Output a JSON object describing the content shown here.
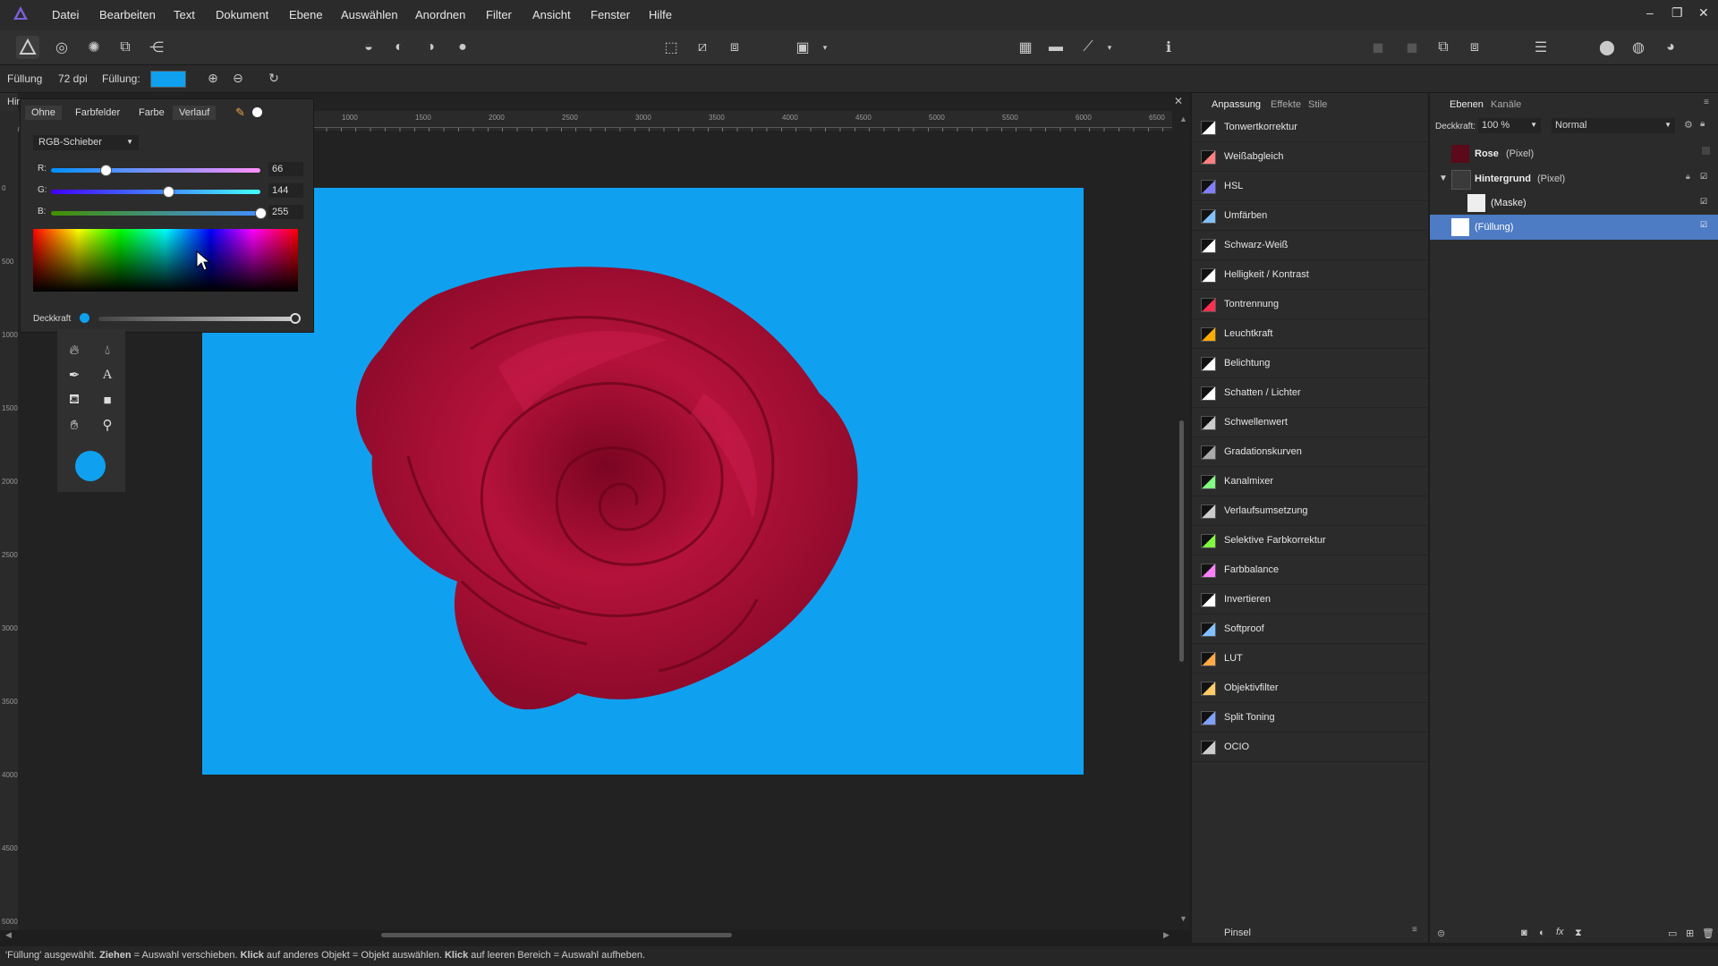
{
  "menu": [
    "Datei",
    "Bearbeiten",
    "Text",
    "Dokument",
    "Ebene",
    "Auswählen",
    "Anordnen",
    "Filter",
    "Ansicht",
    "Fenster",
    "Hilfe"
  ],
  "context": {
    "fill_label": "Füllung",
    "dpi": "72 dpi",
    "fill2_label": "Füllung:",
    "fill_color": "#0fa1f0"
  },
  "color_popup": {
    "tabs": [
      "Ohne",
      "Farbfelder",
      "Farbe",
      "Verlauf"
    ],
    "mode": "RGB-Schieber",
    "r_label": "R:",
    "g_label": "G:",
    "b_label": "B:",
    "r": "66",
    "g": "144",
    "b": "255",
    "r_frac": 0.26,
    "g_frac": 0.56,
    "b_frac": 1.0,
    "opacity_label": "Deckkraft",
    "opacity_frac": 1.0
  },
  "doc_tab": "Hin",
  "ruler_labels": [
    "1000",
    "1500",
    "2000",
    "2500",
    "3000",
    "3500",
    "4000",
    "4500",
    "5000",
    "5500",
    "6000",
    "6500"
  ],
  "ruler_left_labels": [
    "0",
    "500",
    "1000",
    "1500",
    "2000",
    "2500",
    "3000",
    "3500",
    "4000",
    "4500",
    "5000"
  ],
  "adjust_panel": {
    "tabs": [
      "Anpassung",
      "Effekte",
      "Stile"
    ],
    "items": [
      "Tonwertkorrektur",
      "Weißabgleich",
      "HSL",
      "Umfärben",
      "Schwarz-Weiß",
      "Helligkeit / Kontrast",
      "Tontrennung",
      "Leuchtkraft",
      "Belichtung",
      "Schatten / Lichter",
      "Schwellenwert",
      "Gradationskurven",
      "Kanalmixer",
      "Verlaufsumsetzung",
      "Selektive Farbkorrektur",
      "Farbbalance",
      "Invertieren",
      "Softproof",
      "LUT",
      "Objektivfilter",
      "Split Toning",
      "OCIO"
    ],
    "bottom_label": "Pinsel"
  },
  "layers_panel": {
    "tabs": [
      "Ebenen",
      "Kanäle"
    ],
    "opacity_label": "Deckkraft:",
    "opacity_value": "100 %",
    "blend_mode": "Normal",
    "layers": [
      {
        "name": "Rose",
        "type": "(Pixel)"
      },
      {
        "name": "Hintergrund",
        "type": "(Pixel)"
      },
      {
        "name": "",
        "type": "(Maske)"
      },
      {
        "name": "",
        "type": "(Füllung)"
      }
    ]
  },
  "status": {
    "p1": "'Füllung' ausgewählt. ",
    "b1": "Ziehen",
    "p2": " = Auswahl verschieben. ",
    "b2": "Klick",
    "p3": " auf anderes Objekt = Objekt auswählen. ",
    "b3": "Klick",
    "p4": " auf leeren Bereich = Auswahl aufheben."
  }
}
